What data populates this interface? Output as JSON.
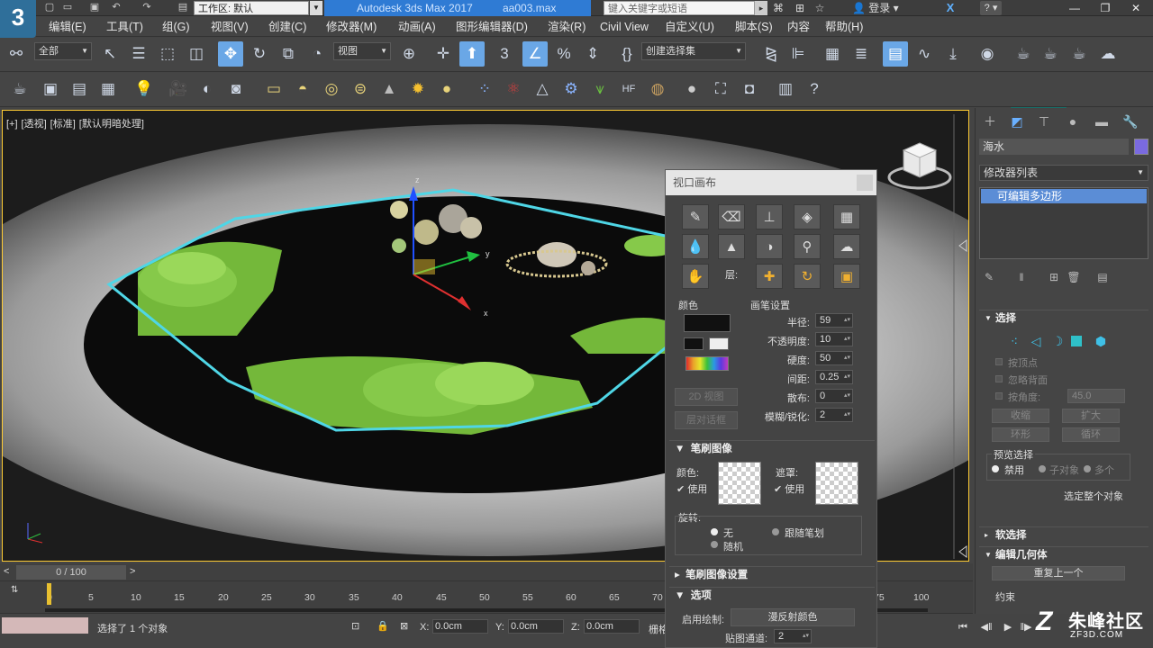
{
  "titlebar": {
    "workspace_label": "工作区: 默认",
    "app_title": "Autodesk 3ds Max 2017",
    "file_name": "aa003.max",
    "search_placeholder": "键入关键字或短语",
    "login": "登录"
  },
  "menu": [
    "编辑(E)",
    "工具(T)",
    "组(G)",
    "视图(V)",
    "创建(C)",
    "修改器(M)",
    "动画(A)",
    "图形编辑器(D)",
    "渲染(R)",
    "Civil View",
    "自定义(U)",
    "脚本(S)",
    "内容",
    "帮助(H)"
  ],
  "toolbar": {
    "filter": "全部",
    "ref_coord": "视图",
    "selection_set": "创建选择集",
    "snap_label": "3"
  },
  "viewport": {
    "labels": [
      "[+]",
      "[透视]",
      "[标准]",
      "[默认明暗处理]"
    ]
  },
  "paint": {
    "title": "视口画布",
    "color_group": "颜色",
    "brush_group": "画笔设置",
    "btn_2d": "2D 视图",
    "btn_dialog": "层对话框",
    "rows": [
      {
        "label": "半径:",
        "value": "59"
      },
      {
        "label": "不透明度:",
        "value": "10"
      },
      {
        "label": "硬度:",
        "value": "50"
      },
      {
        "label": "间距:",
        "value": "0.25"
      },
      {
        "label": "散布:",
        "value": "0"
      },
      {
        "label": "模糊/锐化:",
        "value": "2"
      }
    ],
    "brush_image_section": "笔刷图像",
    "color_label": "颜色:",
    "mask_label": "遮罩:",
    "use_label": "使用",
    "use_label2": "使用",
    "rotate_label": "旋转:",
    "rot_none": "无",
    "rot_follow": "跟随笔划",
    "rot_random": "随机",
    "brush_image_settings": "笔刷图像设置",
    "options_section": "选项",
    "enable_paint": "启用绘制:",
    "reflect_btn": "漫反射颜色",
    "map_channel_label": "贴图通道:",
    "map_channel": "2"
  },
  "cmd": {
    "object_name": "海水",
    "object_color": "#7a6ae0",
    "modifier_list": "修改器列表",
    "stack_item": "可编辑多边形",
    "selection_section": "选择",
    "by_vertex": "按顶点",
    "ignore_back": "忽略背面",
    "by_angle": "按角度:",
    "angle_value": "45.0",
    "shrink": "收缩",
    "grow": "扩大",
    "ring": "环形",
    "loop": "循环",
    "preview_label": "预览选择",
    "preview_off": "禁用",
    "preview_sub": "子对象",
    "preview_multi": "多个",
    "select_whole": "选定整个对象",
    "soft_selection": "软选择",
    "edit_geometry": "编辑几何体",
    "repeat_last": "重复上一个",
    "constraints": "约束"
  },
  "timeline": {
    "slider": "0 / 100",
    "ticks": [
      "0",
      "5",
      "10",
      "15",
      "20",
      "25",
      "30",
      "35",
      "40",
      "45",
      "50",
      "55",
      "60",
      "65",
      "70",
      "75",
      "100"
    ]
  },
  "status": {
    "message": "选择了 1 个对象",
    "x": "0.0cm",
    "y": "0.0cm",
    "z": "0.0cm",
    "x_label": "X:",
    "y_label": "Y:",
    "z_label": "Z:",
    "grid_label": "栅格"
  },
  "watermark": {
    "brand": "朱峰社区",
    "url": "ZF3D.COM"
  },
  "colors": {
    "accent": "#2f7bd4",
    "active_tool": "#6aa7e6",
    "selection_cage": "#4fd6e6",
    "island_green": "#86c94a",
    "highlight": "#17706a"
  }
}
